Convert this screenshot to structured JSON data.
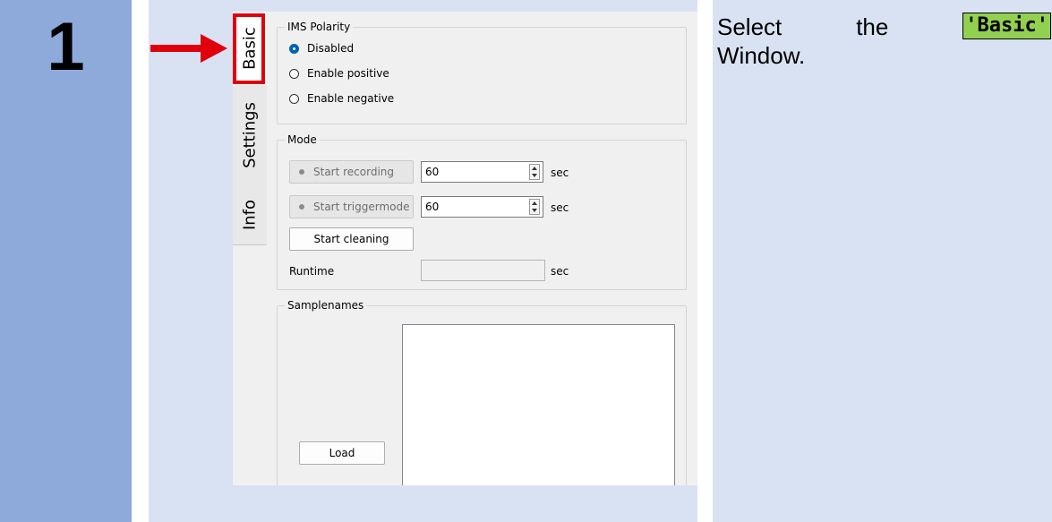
{
  "step": {
    "number": "1"
  },
  "instruction": {
    "word1": "Select",
    "word2": "the",
    "highlight": "'Basic'",
    "line2": "Window."
  },
  "tabs": [
    {
      "label": "Basic",
      "active": true
    },
    {
      "label": "Settings",
      "active": false
    },
    {
      "label": "Info",
      "active": false
    }
  ],
  "ims_polarity": {
    "title": "IMS Polarity",
    "options": [
      {
        "label": "Disabled",
        "checked": true
      },
      {
        "label": "Enable positive",
        "checked": false
      },
      {
        "label": "Enable negative",
        "checked": false
      }
    ]
  },
  "mode": {
    "title": "Mode",
    "start_recording": {
      "label": "Start recording",
      "value": "60",
      "unit": "sec"
    },
    "start_triggermode": {
      "label": "Start triggermode",
      "value": "60",
      "unit": "sec"
    },
    "start_cleaning": {
      "label": "Start cleaning"
    },
    "runtime": {
      "label": "Runtime",
      "value": "",
      "unit": "sec"
    }
  },
  "samplenames": {
    "title": "Samplenames",
    "load_label": "Load"
  },
  "colors": {
    "step_column": "#8eaadb",
    "panel_background": "#d9e2f3",
    "arrow": "#e0000b",
    "highlight": "#92d050",
    "radio_checked": "#0063b1"
  }
}
